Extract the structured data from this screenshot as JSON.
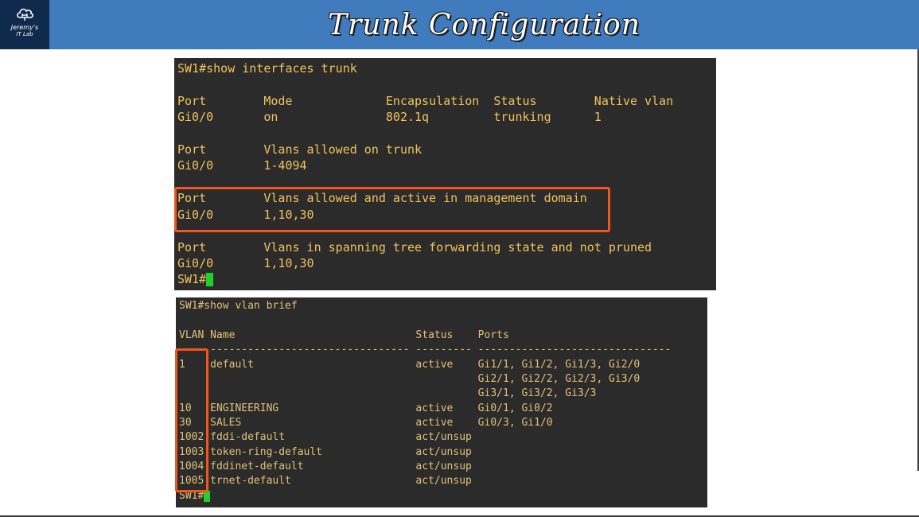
{
  "header": {
    "title": "Trunk Configuration",
    "logo_line1": "Jeremy's",
    "logo_line2": "IT Lab",
    "logo_icon": "cloud-network-icon"
  },
  "colors": {
    "header_bg": "#3f7bbd",
    "logo_bg": "#0f2a4d",
    "terminal_bg": "#2b2b2b",
    "terminal_text": "#f2c25a",
    "highlight": "#f2561c",
    "cursor": "#21d12b"
  },
  "terminal1": {
    "lines": [
      "SW1#show interfaces trunk",
      "",
      "Port        Mode             Encapsulation  Status        Native vlan",
      "Gi0/0       on               802.1q         trunking      1",
      "",
      "Port        Vlans allowed on trunk",
      "Gi0/0       1-4094",
      "",
      "Port        Vlans allowed and active in management domain",
      "Gi0/0       1,10,30",
      "",
      "Port        Vlans in spanning tree forwarding state and not pruned",
      "Gi0/0       1,10,30"
    ],
    "prompt": "SW1#"
  },
  "terminal2": {
    "lines": [
      "SW1#show vlan brief",
      "",
      "VLAN Name                             Status    Ports",
      "---- -------------------------------- --------- -------------------------------",
      "1    default                          active    Gi1/1, Gi1/2, Gi1/3, Gi2/0",
      "                                                Gi2/1, Gi2/2, Gi2/3, Gi3/0",
      "                                                Gi3/1, Gi3/2, Gi3/3",
      "10   ENGINEERING                      active    Gi0/1, Gi0/2",
      "30   SALES                            active    Gi0/3, Gi1/0",
      "1002 fddi-default                     act/unsup",
      "1003 token-ring-default               act/unsup",
      "1004 fddinet-default                  act/unsup",
      "1005 trnet-default                    act/unsup"
    ],
    "prompt": "SW1#"
  }
}
